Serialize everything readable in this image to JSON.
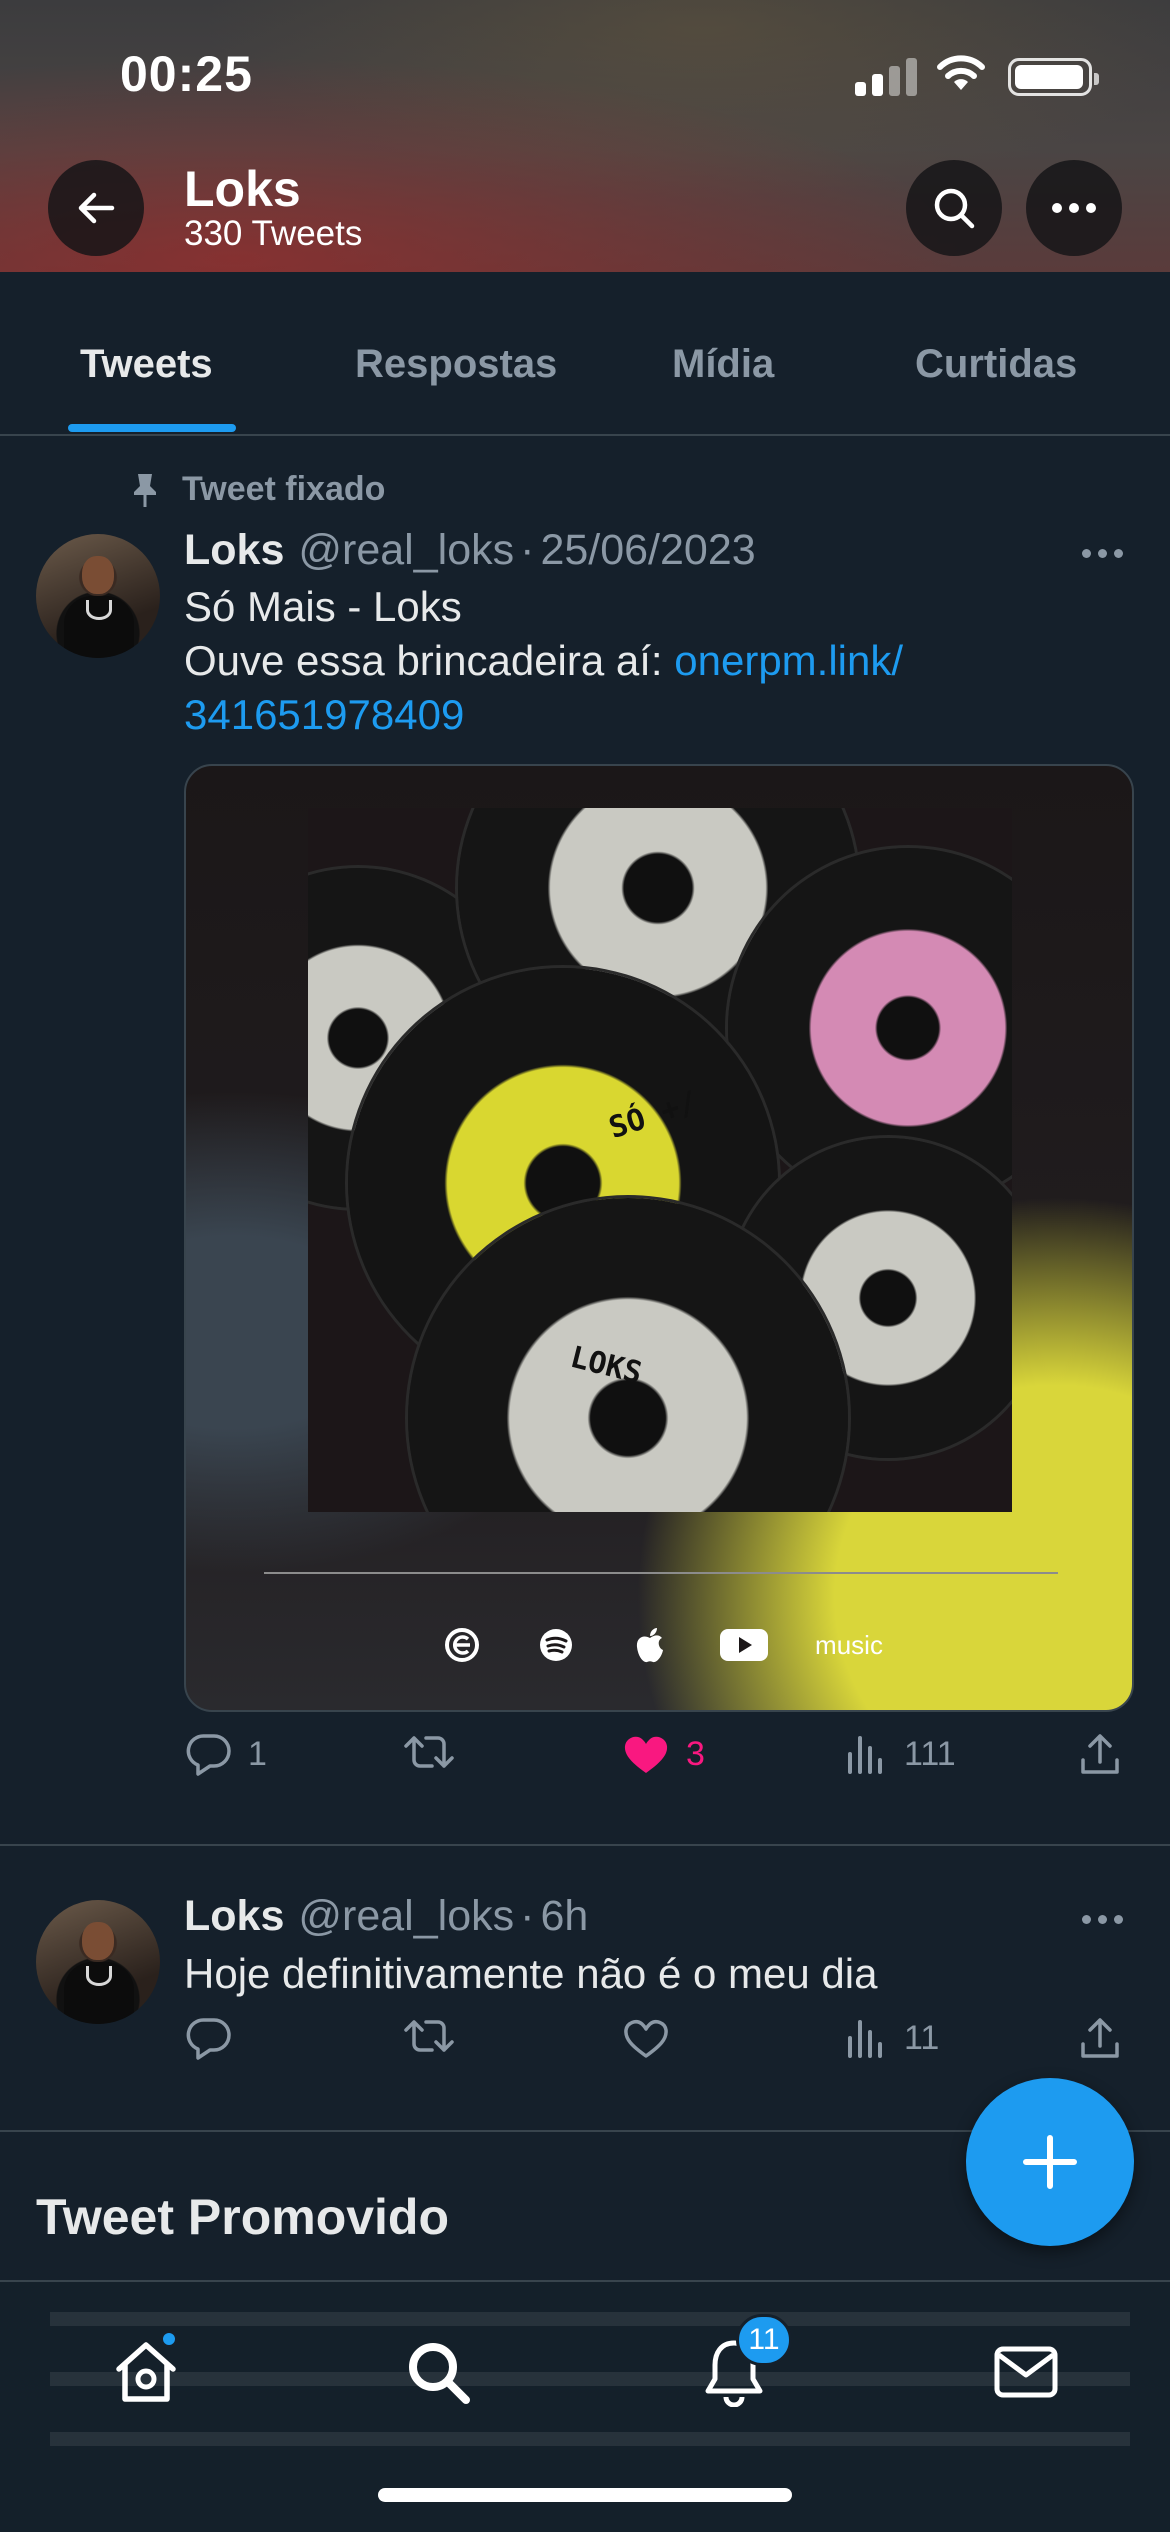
{
  "status_bar": {
    "time": "00:25"
  },
  "header": {
    "name": "Loks",
    "tweet_count": "330 Tweets"
  },
  "tabs": [
    {
      "label": "Tweets",
      "active": true
    },
    {
      "label": "Respostas",
      "active": false
    },
    {
      "label": "Mídia",
      "active": false
    },
    {
      "label": "Curtidas",
      "active": false
    }
  ],
  "pinned_tweet": {
    "pinned_label": "Tweet fixado",
    "name": "Loks",
    "handle": "@real_loks",
    "separator": "·",
    "date": "25/06/2023",
    "line1": "Só Mais - Loks",
    "line2_text": "Ouve essa brincadeira aí: ",
    "link_part1": "onerpm.link/",
    "link_part2": "341651978409",
    "media": {
      "label_top": "SÓ +/",
      "label_bottom": "LOKS",
      "platforms": [
        "onerpm",
        "spotify",
        "apple",
        "youtube",
        "music"
      ],
      "music_text": "music"
    },
    "replies": "1",
    "retweets": "",
    "likes": "3",
    "views": "111"
  },
  "tweet2": {
    "name": "Loks",
    "handle": "@real_loks",
    "separator": "·",
    "time": "6h",
    "text": "Hoje definitivamente não é o meu dia",
    "replies": "",
    "retweets": "",
    "likes": "",
    "views": "11"
  },
  "promoted_label": "Tweet Promovido",
  "bottom_nav": {
    "notifications_badge": "11"
  },
  "colors": {
    "accent": "#1d9bf0",
    "like": "#f91880",
    "background": "#15202b",
    "muted": "#8b98a5"
  }
}
